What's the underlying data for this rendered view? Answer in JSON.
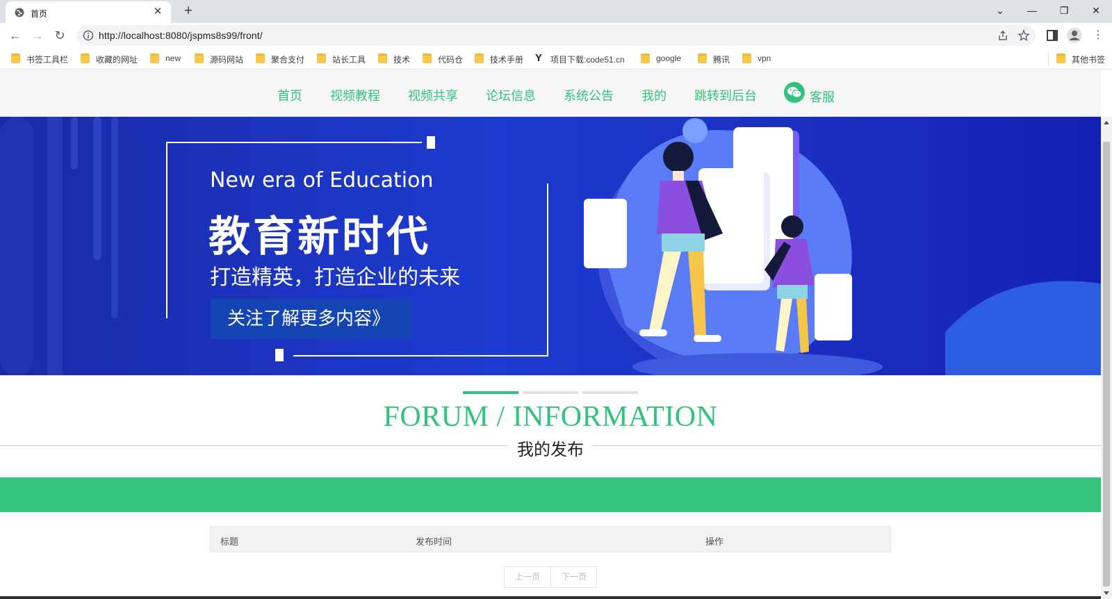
{
  "browser": {
    "tab_title": "首页",
    "url": "http://localhost:8080/jspms8s99/front/",
    "bookmarks": [
      "书签工具栏",
      "收藏的网址",
      "new",
      "源码网站",
      "聚合支付",
      "站长工具",
      "技术",
      "代码仓",
      "技术手册",
      "项目下载:code51.cn",
      "google",
      "腾讯",
      "vpn"
    ],
    "other_bookmarks": "其他书签"
  },
  "nav": {
    "items": [
      "首页",
      "视频教程",
      "视频共享",
      "论坛信息",
      "系统公告",
      "我的",
      "跳转到后台"
    ],
    "service_label": "客服"
  },
  "banner": {
    "english": "New era of Education",
    "headline": "教育新时代",
    "subline": "打造精英，打造企业的未来",
    "cta": "关注了解更多内容》"
  },
  "section": {
    "title": "FORUM / INFORMATION",
    "subtitle": "我的发布"
  },
  "table": {
    "columns": [
      "标题",
      "发布时间",
      "操作"
    ]
  },
  "pager": {
    "prev": "上一页",
    "next": "下一页"
  },
  "colors": {
    "accent": "#31c27c",
    "banner_bg": "#1d3bd0"
  }
}
